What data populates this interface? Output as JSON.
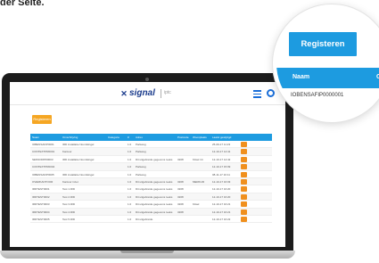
{
  "caption": "der Seite.",
  "app": {
    "logo": "signal",
    "logo_sub": "iptc",
    "register_button": "Registeren"
  },
  "table": {
    "headers": [
      "Naam",
      "Omschrijving",
      "Categorie",
      "#",
      "Adres",
      "Postcode",
      "Woonplaats",
      "Laatst gewijzigd",
      ""
    ],
    "rows": [
      [
        "IOBENSAFIP0001",
        "IRD installatie Noordsingel",
        "",
        "1.0",
        "Parkweg",
        "",
        "",
        "25-09-17 11:23",
        ""
      ],
      [
        "CONTEXTPR0001",
        "Kantoor",
        "",
        "1.0",
        "Parkweg",
        "",
        "",
        "12-10-17 14:41",
        ""
      ],
      [
        "SENSORPR0003",
        "IRD installatie Noordsingel",
        "",
        "1.0",
        "Dit uitgebreide gegevens reeks",
        "3208",
        "Kitsel 14",
        "12-10-17 14:42",
        ""
      ],
      [
        "CONTEXTPR0004",
        "",
        "",
        "1.0",
        "Parkweg",
        "",
        "",
        "12-10-17 15:09",
        ""
      ],
      [
        "IOBENSAFIP0005",
        "IRD installatie Noordsingel",
        "",
        "1.0",
        "Parkweg",
        "",
        "",
        "08-11-17 10:11",
        ""
      ],
      [
        "OVERKANTOOR",
        "Kantoor inzet",
        "",
        "1.0",
        "Dit uitgebreide gegevens reeks",
        "3208",
        "MERKUR",
        "12-10-17 16:03",
        ""
      ],
      [
        "IRDTEST0001",
        "Test 1.IRD",
        "",
        "1.0",
        "Dit uitgebreide gegevens reeks",
        "3208",
        "",
        "12-10-17 16:20",
        ""
      ],
      [
        "IRDTEST0002",
        "Test 2.IRD",
        "",
        "1.0",
        "Dit uitgebreide gegevens reeks",
        "3208",
        "",
        "12-10-17 16:20",
        ""
      ],
      [
        "IRDTEST0003",
        "Test 3.IRD",
        "",
        "1.0",
        "Dit uitgebreide gegevens reeks",
        "3208",
        "Kitsel",
        "12-10-17 16:21",
        ""
      ],
      [
        "IRDTEST0004",
        "Test 4.IRD",
        "",
        "1.0",
        "Dit uitgebreide gegevens reeks",
        "3208",
        "",
        "12-10-17 16:21",
        ""
      ],
      [
        "IRDTEST0005",
        "Test 5.IRD",
        "",
        "1.0",
        "Dit uitgebreide",
        "",
        "",
        "12-10-17 16:22",
        ""
      ]
    ]
  },
  "magnifier": {
    "button": "Registeren",
    "col1": "Naam",
    "col2": "Om",
    "value": "IOBENSAFIP0000001"
  },
  "colors": {
    "accent": "#1d9be0",
    "action": "#f0901e",
    "brand": "#1a3b8c"
  },
  "icons": [
    "menu-icon",
    "settings-icon",
    "signal-logo-icon"
  ]
}
